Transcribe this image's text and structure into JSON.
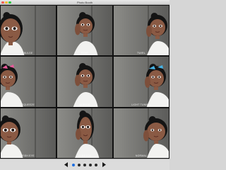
{
  "window": {
    "title": "Photo Booth"
  },
  "effects": [
    {
      "id": "bulge",
      "label": "BULGE",
      "color": "#f5f0ec"
    },
    {
      "id": "dent",
      "label": "DENT",
      "color": "#f5f0ec"
    },
    {
      "id": "twirl",
      "label": "TWIRL",
      "color": "#f5f0ec"
    },
    {
      "id": "squeeze",
      "label": "SQUEEZE",
      "color": "#f5f0ec"
    },
    {
      "id": "mirror",
      "label": "MIRROR",
      "color": "#f5f0ec"
    },
    {
      "id": "light-tunnel",
      "label": "LIGHT TUNNEL",
      "color": "#f5f0ec"
    },
    {
      "id": "fish-eye",
      "label": "FISH EYE",
      "color": "#f5f0ec"
    },
    {
      "id": "stretch",
      "label": "STRETCH",
      "color": "#f5f0ec"
    },
    {
      "id": "normal",
      "label": "NORMAL",
      "color": "#f5f0ec"
    }
  ],
  "pager": {
    "prev_icon": "chevron-left-icon",
    "next_icon": "chevron-right-icon",
    "page_count": 5,
    "current_page": 1
  },
  "colors": {
    "accent": "#1e6ee0",
    "wall_left": "#8c8c88",
    "wall_right": "#5a5a58",
    "skin": "#8a5a44",
    "hair": "#141414",
    "shirt": "#f2f2f0",
    "hair_clip_pink": "#e85a9a",
    "hair_clip_blue": "#46b4e6"
  }
}
